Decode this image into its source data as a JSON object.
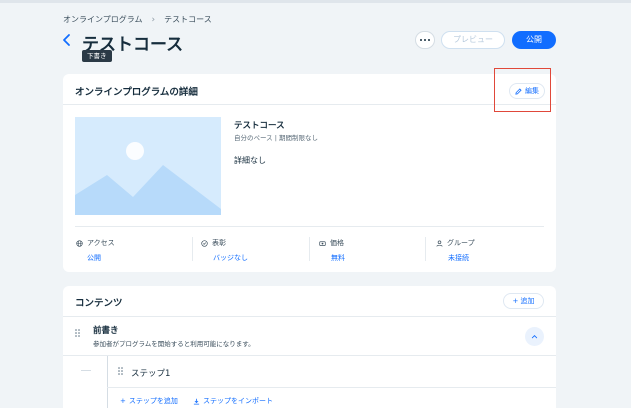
{
  "breadcrumb": {
    "parent": "オンラインプログラム",
    "separator": "›",
    "current": "テストコース"
  },
  "header": {
    "title": "テストコース",
    "badge": "下書き",
    "preview_label": "プレビュー",
    "publish_label": "公開"
  },
  "details": {
    "section_title": "オンラインプログラムの詳細",
    "edit_label": "編集",
    "program_name": "テストコース",
    "program_sub": "自分のペース | 期間制限なし",
    "description": "詳細なし",
    "meta": [
      {
        "label": "アクセス",
        "value": "公開",
        "icon": "globe-icon"
      },
      {
        "label": "表彰",
        "value": "バッジなし",
        "icon": "award-icon"
      },
      {
        "label": "価格",
        "value": "無料",
        "icon": "price-icon"
      },
      {
        "label": "グループ",
        "value": "未接続",
        "icon": "group-icon"
      }
    ]
  },
  "contents": {
    "section_title": "コンテンツ",
    "add_label": "+ 追加",
    "preface_title": "前書き",
    "preface_sub": "参加者がプログラムを開始すると利用可能になります。",
    "step_title": "ステップ1",
    "add_step_label": "ステップを追加",
    "import_step_label": "ステップをインポート"
  },
  "colors": {
    "accent": "#116dff",
    "background": "#f0f4f7",
    "highlight": "#e0483a"
  }
}
